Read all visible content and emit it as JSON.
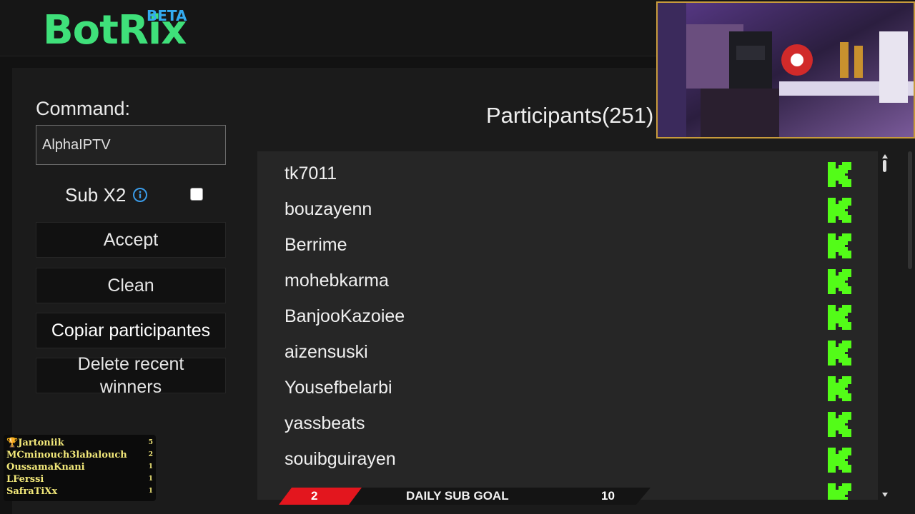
{
  "header": {
    "logo": "BotRix",
    "badge": "BETA"
  },
  "form": {
    "command_label": "Command:",
    "command_value": "AlphaIPTV",
    "subx2_label": "Sub X2",
    "subx2_checked": false
  },
  "buttons": {
    "accept": "Accept",
    "clean": "Clean",
    "copy": "Copiar participantes",
    "delete_line1": "Delete recent",
    "delete_line2": "winners"
  },
  "participants": {
    "title": "Participants(251)",
    "items": [
      {
        "name": "tk7011",
        "platform": "kick-icon"
      },
      {
        "name": "bouzayenn",
        "platform": "kick-icon"
      },
      {
        "name": "Berrime",
        "platform": "kick-icon"
      },
      {
        "name": "mohebkarma",
        "platform": "kick-icon"
      },
      {
        "name": "BanjooKazoiee",
        "platform": "kick-icon"
      },
      {
        "name": "aizensuski",
        "platform": "kick-icon"
      },
      {
        "name": "Yousefbelarbi",
        "platform": "kick-icon"
      },
      {
        "name": "yassbeats",
        "platform": "kick-icon"
      },
      {
        "name": "souibguirayen",
        "platform": "kick-icon"
      },
      {
        "name": "",
        "platform": "kick-icon"
      }
    ]
  },
  "winners": [
    {
      "name": "Jartoniik",
      "count": "5",
      "trophy": true
    },
    {
      "name": "MCminouch3labalouch",
      "count": "2"
    },
    {
      "name": "OussamaKnani",
      "count": "1"
    },
    {
      "name": "LFerssi",
      "count": "1"
    },
    {
      "name": "SafraTiXx",
      "count": "1"
    }
  ],
  "sub_goal": {
    "label": "DAILY SUB GOAL",
    "current": "2",
    "target": "10"
  },
  "colors": {
    "brand": "#3fe07a",
    "badge": "#33aaf0",
    "kick": "#53fc18",
    "goal_red": "#e3161e"
  }
}
